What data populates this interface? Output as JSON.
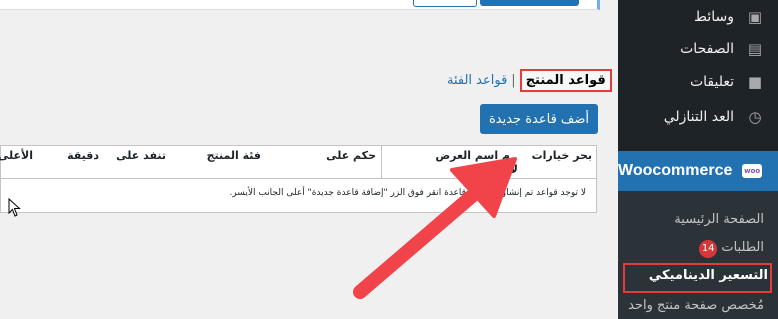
{
  "sidebar": {
    "items": [
      {
        "label": "وسائط",
        "icon": "media-icon",
        "glyph": "▣"
      },
      {
        "label": "الصفحات",
        "icon": "pages-icon",
        "glyph": "▤"
      },
      {
        "label": "تعليقات",
        "icon": "comments-icon",
        "glyph": "■"
      },
      {
        "label": "العد التنازلي",
        "icon": "clock-icon",
        "glyph": "◷"
      }
    ],
    "woocommerce": {
      "label": "Woocommerce",
      "icon_text": "woo"
    },
    "submenu": {
      "home": "الصفحة الرئيسية",
      "orders": "الطلبات",
      "orders_count": "14",
      "dynamic_pricing": "التسعير الديناميكي",
      "product_page": "مُخصص صفحة منتج واحد"
    }
  },
  "subsub": {
    "current": "قواعد المنتج",
    "separator": "|",
    "category_rules": "قواعد الفئة"
  },
  "add_button": "أضف قاعدة جديدة",
  "table": {
    "columns": [
      "بحر خيارات",
      "م اسم العرض",
      "حكم على",
      "فئة المنتج",
      "تنفد على",
      "دقيقة",
      "الأعلى"
    ],
    "row_hint": "لا",
    "empty_message": "لا توجد قواعد تم إنشاؤها لإنشاء قاعدة انقر فوق الزر \"إضافة قاعدة جديدة\" أعلى الجانب الأيسر."
  },
  "colors": {
    "accent": "#2271b1",
    "highlight": "#e53b3b",
    "arrow": "#f0444a",
    "sidebar": "#1d2327"
  }
}
